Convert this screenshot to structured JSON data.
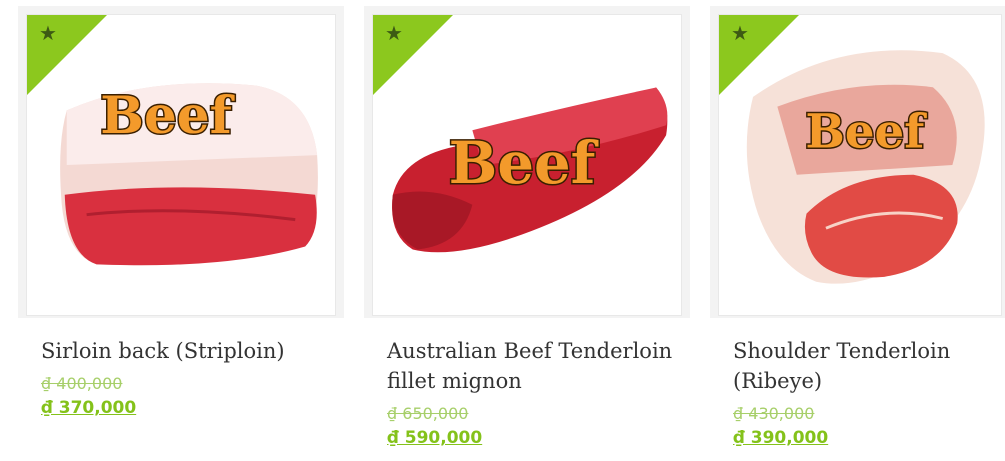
{
  "theme": {
    "accent": "#8cc81e",
    "star_color": "#3d5a14",
    "price_color": "#84c21a",
    "old_price_color": "#a7cf6a"
  },
  "products": [
    {
      "badge_icon": "star-icon",
      "badge_glyph": "★",
      "image_label": "Beef",
      "name": "Sirloin back (Striploin)",
      "old_price": "₫ 400,000",
      "price": "₫ 370,000"
    },
    {
      "badge_icon": "star-icon",
      "badge_glyph": "★",
      "image_label": "Beef",
      "name": "Australian Beef Tenderloin fillet mignon",
      "old_price": "₫ 650,000",
      "price": "₫ 590,000"
    },
    {
      "badge_icon": "star-icon",
      "badge_glyph": "★",
      "image_label": "Beef",
      "name": "Shoulder Tenderloin (Ribeye)",
      "old_price": "₫ 430,000",
      "price": "₫ 390,000"
    }
  ]
}
